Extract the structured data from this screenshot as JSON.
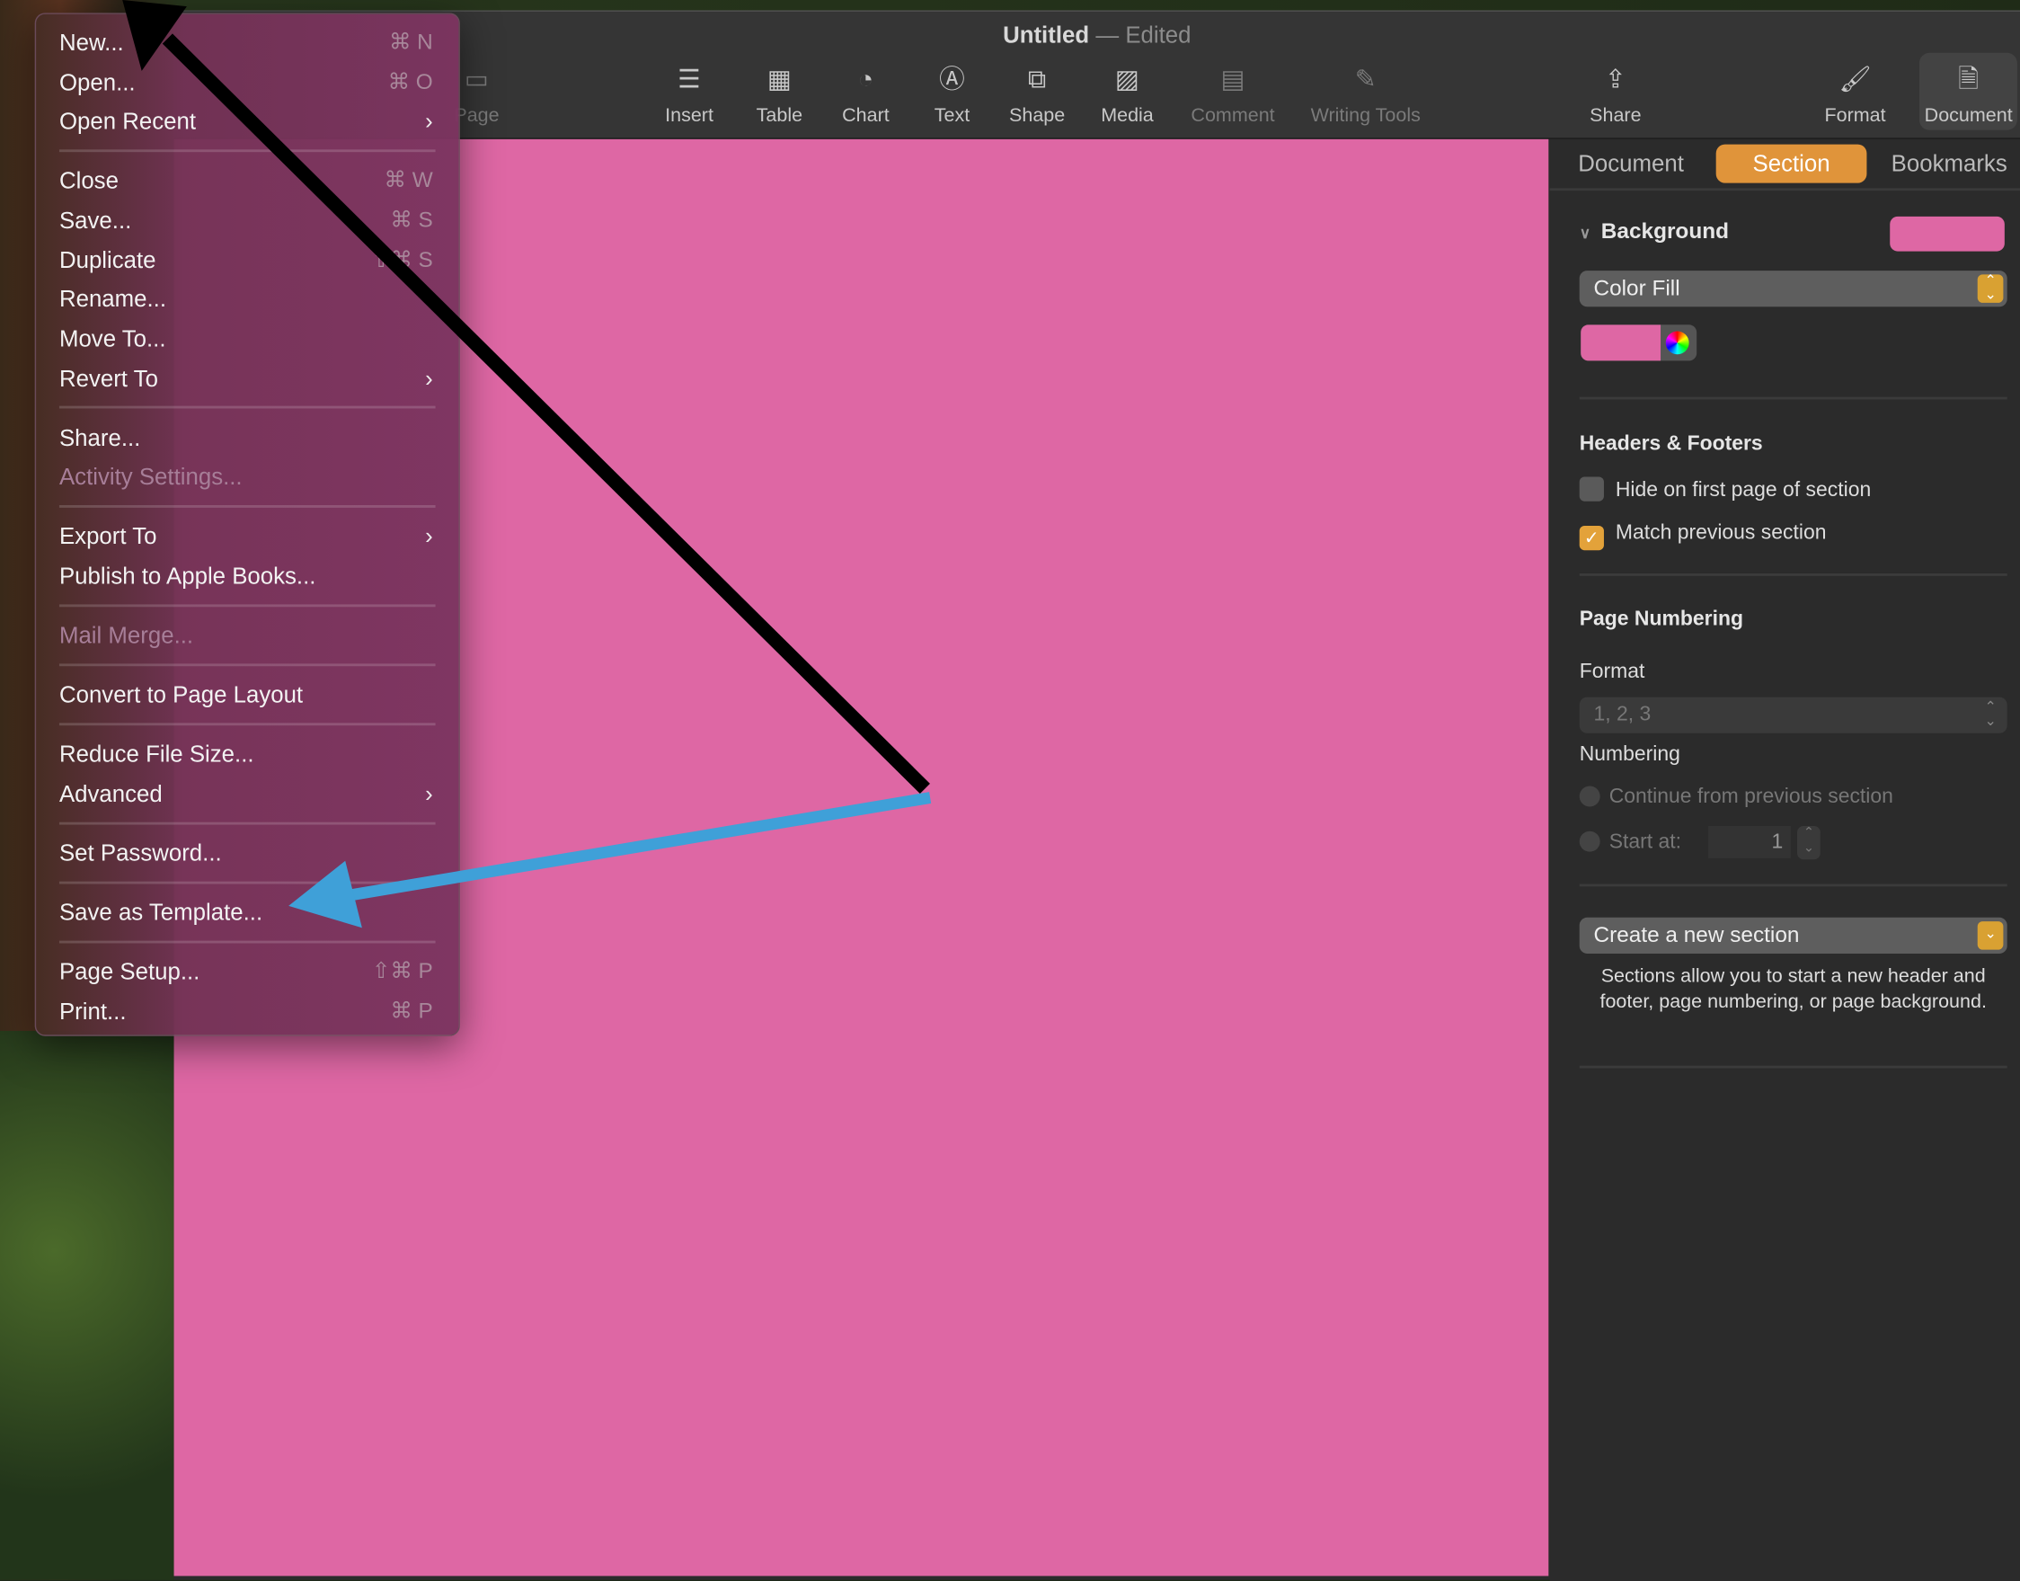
{
  "window": {
    "title": "Untitled",
    "status": "Edited"
  },
  "toolbar": {
    "items": [
      {
        "label": "Page",
        "icon": "page-icon"
      },
      {
        "label": "Insert",
        "icon": "insert-icon"
      },
      {
        "label": "Table",
        "icon": "table-icon"
      },
      {
        "label": "Chart",
        "icon": "chart-icon"
      },
      {
        "label": "Text",
        "icon": "text-icon"
      },
      {
        "label": "Shape",
        "icon": "shape-icon"
      },
      {
        "label": "Media",
        "icon": "media-icon"
      },
      {
        "label": "Comment",
        "icon": "comment-icon"
      },
      {
        "label": "Writing Tools",
        "icon": "writing-tools-icon"
      },
      {
        "label": "Share",
        "icon": "share-icon"
      },
      {
        "label": "Format",
        "icon": "format-brush-icon"
      },
      {
        "label": "Document",
        "icon": "document-icon"
      }
    ]
  },
  "menu": {
    "items": [
      {
        "label": "New...",
        "shortcut": "⌘ N"
      },
      {
        "label": "Open...",
        "shortcut": "⌘ O"
      },
      {
        "label": "Open Recent",
        "submenu": "›"
      },
      {
        "label": "Close",
        "shortcut": "⌘ W"
      },
      {
        "label": "Save...",
        "shortcut": "⌘ S"
      },
      {
        "label": "Duplicate",
        "shortcut": "⇧⌘ S"
      },
      {
        "label": "Rename..."
      },
      {
        "label": "Move To..."
      },
      {
        "label": "Revert To",
        "submenu": "›"
      },
      {
        "label": "Share..."
      },
      {
        "label": "Activity Settings...",
        "disabled": true
      },
      {
        "label": "Export To",
        "submenu": "›"
      },
      {
        "label": "Publish to Apple Books..."
      },
      {
        "label": "Mail Merge...",
        "disabled": true
      },
      {
        "label": "Convert to Page Layout"
      },
      {
        "label": "Reduce File Size..."
      },
      {
        "label": "Advanced",
        "submenu": "›"
      },
      {
        "label": "Set Password..."
      },
      {
        "label": "Save as Template..."
      },
      {
        "label": "Page Setup...",
        "shortcut": "⇧⌘ P"
      },
      {
        "label": "Print...",
        "shortcut": "⌘ P"
      }
    ]
  },
  "panel": {
    "tabs": [
      "Document",
      "Section",
      "Bookmarks"
    ],
    "active_tab": "Section",
    "background": {
      "heading": "Background",
      "fill_type": "Color Fill",
      "color": "#de67a4"
    },
    "headers_footers": {
      "heading": "Headers & Footers",
      "hide_first": {
        "label": "Hide on first page of section",
        "checked": false
      },
      "match_previous": {
        "label": "Match previous section",
        "checked": true
      }
    },
    "page_numbering": {
      "heading": "Page Numbering",
      "format_label": "Format",
      "format_value": "1, 2, 3",
      "numbering_label": "Numbering",
      "continue_label": "Continue from previous section",
      "start_label": "Start at:",
      "start_value": "1"
    },
    "create_section": {
      "label": "Create a new section",
      "description": "Sections allow you to start a new header and footer, page numbering, or page background."
    }
  },
  "colors": {
    "canvas": "#de67a4",
    "accent": "#e0943a",
    "arrow_black": "#000000",
    "arrow_blue": "#3fa0d8"
  }
}
